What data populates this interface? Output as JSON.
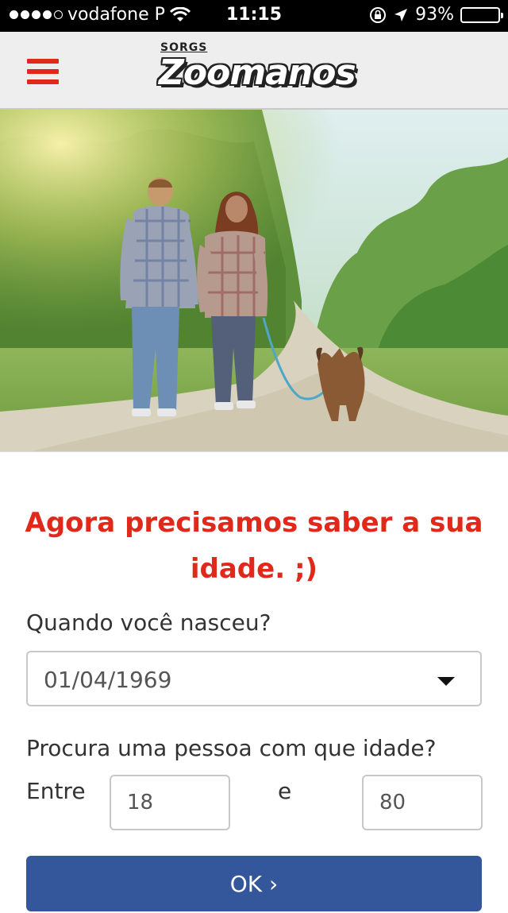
{
  "status_bar": {
    "carrier": "vodafone P",
    "time": "11:15",
    "battery_percent": "93%",
    "battery_level": 0.93,
    "signal_bars_filled": 4,
    "signal_bars_total": 5
  },
  "navbar": {
    "menu_icon": "hamburger-icon",
    "logo_top_text": "SORGS",
    "logo_main_text": "Zoomanos",
    "accent_color": "#e0291b"
  },
  "hero": {
    "image": "couple-walking-dog-on-forest-path"
  },
  "form": {
    "heading": "Agora precisamos saber a sua idade. ;)",
    "birth_question": "Quando você nasceu?",
    "birth_date_value": "01/04/1969",
    "age_question": "Procura uma pessoa com que idade?",
    "between_label": "Entre",
    "and_label": "e",
    "age_min": "18",
    "age_max": "80",
    "ok_label": "OK  ›",
    "button_color": "#34579b"
  }
}
